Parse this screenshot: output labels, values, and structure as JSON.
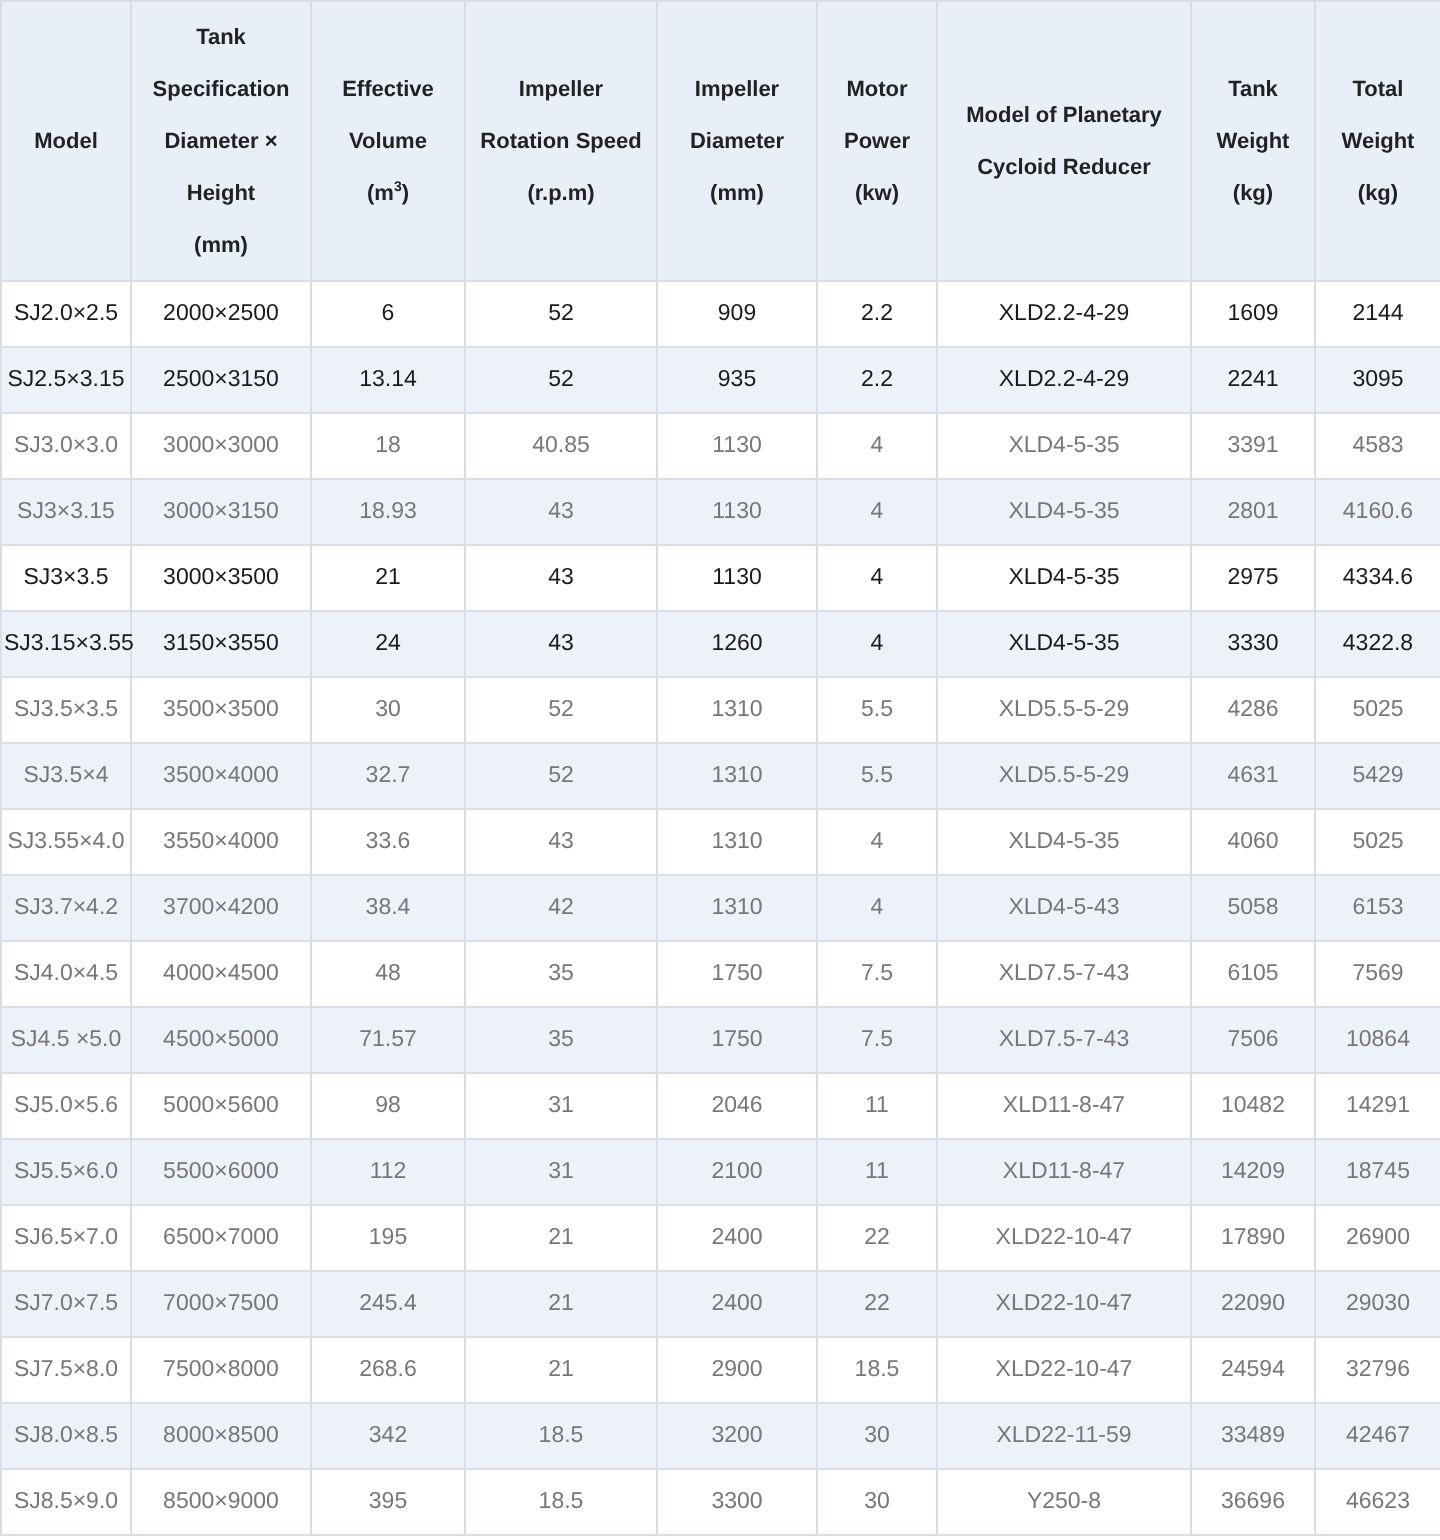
{
  "table": {
    "columns": [
      "Model",
      "Tank\nSpecification\nDiameter ×\nHeight\n(mm)",
      "Effective\nVolume\n(m$^{3}$)",
      "Impeller\nRotation Speed\n(r.p.m)",
      "Impeller\nDiameter\n(mm)",
      "Motor\nPower\n(kw)",
      "Model of Planetary\nCycloid Reducer",
      "Tank\nWeight\n(kg)",
      "Total\nWeight\n(kg)"
    ],
    "rows": [
      {
        "kind": "dark",
        "cells": [
          "SJ2.0×2.5",
          "2000×2500",
          "6",
          "52",
          "909",
          "2.2",
          "XLD2.2-4-29",
          "1609",
          "2144"
        ]
      },
      {
        "kind": "dark",
        "cells": [
          "SJ2.5×3.15",
          "2500×3150",
          "13.14",
          "52",
          "935",
          "2.2",
          "XLD2.2-4-29",
          "2241",
          "3095"
        ]
      },
      {
        "kind": "plain",
        "cells": [
          "SJ3.0×3.0",
          "3000×3000",
          "18",
          "40.85",
          "1130",
          "4",
          "XLD4-5-35",
          "3391",
          "4583"
        ]
      },
      {
        "kind": "plain",
        "cells": [
          "SJ3×3.15",
          "3000×3150",
          "18.93",
          "43",
          "1130",
          "4",
          "XLD4-5-35",
          "2801",
          "4160.6"
        ]
      },
      {
        "kind": "dark",
        "cells": [
          "SJ3×3.5",
          "3000×3500",
          "21",
          "43",
          "1130",
          "4",
          "XLD4-5-35",
          "2975",
          "4334.6"
        ]
      },
      {
        "kind": "dark",
        "cells": [
          "SJ3.15×3.55",
          "3150×3550",
          "24",
          "43",
          "1260",
          "4",
          "XLD4-5-35",
          "3330",
          "4322.8"
        ]
      },
      {
        "kind": "plain",
        "cells": [
          "SJ3.5×3.5",
          "3500×3500",
          "30",
          "52",
          "1310",
          "5.5",
          "XLD5.5-5-29",
          "4286",
          "5025"
        ]
      },
      {
        "kind": "plain",
        "cells": [
          "SJ3.5×4",
          "3500×4000",
          "32.7",
          "52",
          "1310",
          "5.5",
          "XLD5.5-5-29",
          "4631",
          "5429"
        ]
      },
      {
        "kind": "plain",
        "cells": [
          "SJ3.55×4.0",
          "3550×4000",
          "33.6",
          "43",
          "1310",
          "4",
          "XLD4-5-35",
          "4060",
          "5025"
        ]
      },
      {
        "kind": "plain",
        "cells": [
          "SJ3.7×4.2",
          "3700×4200",
          "38.4",
          "42",
          "1310",
          "4",
          "XLD4-5-43",
          "5058",
          "6153"
        ]
      },
      {
        "kind": "plain",
        "cells": [
          "SJ4.0×4.5",
          "4000×4500",
          "48",
          "35",
          "1750",
          "7.5",
          "XLD7.5-7-43",
          "6105",
          "7569"
        ]
      },
      {
        "kind": "plain",
        "cells": [
          "SJ4.5 ×5.0",
          "4500×5000",
          "71.57",
          "35",
          "1750",
          "7.5",
          "XLD7.5-7-43",
          "7506",
          "10864"
        ]
      },
      {
        "kind": "plain",
        "cells": [
          "SJ5.0×5.6",
          "5000×5600",
          "98",
          "31",
          "2046",
          "11",
          "XLD11-8-47",
          "10482",
          "14291"
        ]
      },
      {
        "kind": "plain",
        "cells": [
          "SJ5.5×6.0",
          "5500×6000",
          "112",
          "31",
          "2100",
          "11",
          "XLD11-8-47",
          "14209",
          "18745"
        ]
      },
      {
        "kind": "plain",
        "cells": [
          "SJ6.5×7.0",
          "6500×7000",
          "195",
          "21",
          "2400",
          "22",
          "XLD22-10-47",
          "17890",
          "26900"
        ]
      },
      {
        "kind": "plain",
        "cells": [
          "SJ7.0×7.5",
          "7000×7500",
          "245.4",
          "21",
          "2400",
          "22",
          "XLD22-10-47",
          "22090",
          "29030"
        ]
      },
      {
        "kind": "plain",
        "cells": [
          "SJ7.5×8.0",
          "7500×8000",
          "268.6",
          "21",
          "2900",
          "18.5",
          "XLD22-10-47",
          "24594",
          "32796"
        ]
      },
      {
        "kind": "plain",
        "cells": [
          "SJ8.0×8.5",
          "8000×8500",
          "342",
          "18.5",
          "3200",
          "30",
          "XLD22-11-59",
          "33489",
          "42467"
        ]
      },
      {
        "kind": "plain",
        "cells": [
          "SJ8.5×9.0",
          "8500×9000",
          "395",
          "18.5",
          "3300",
          "30",
          "Y250-8",
          "36696",
          "46623"
        ]
      }
    ]
  }
}
